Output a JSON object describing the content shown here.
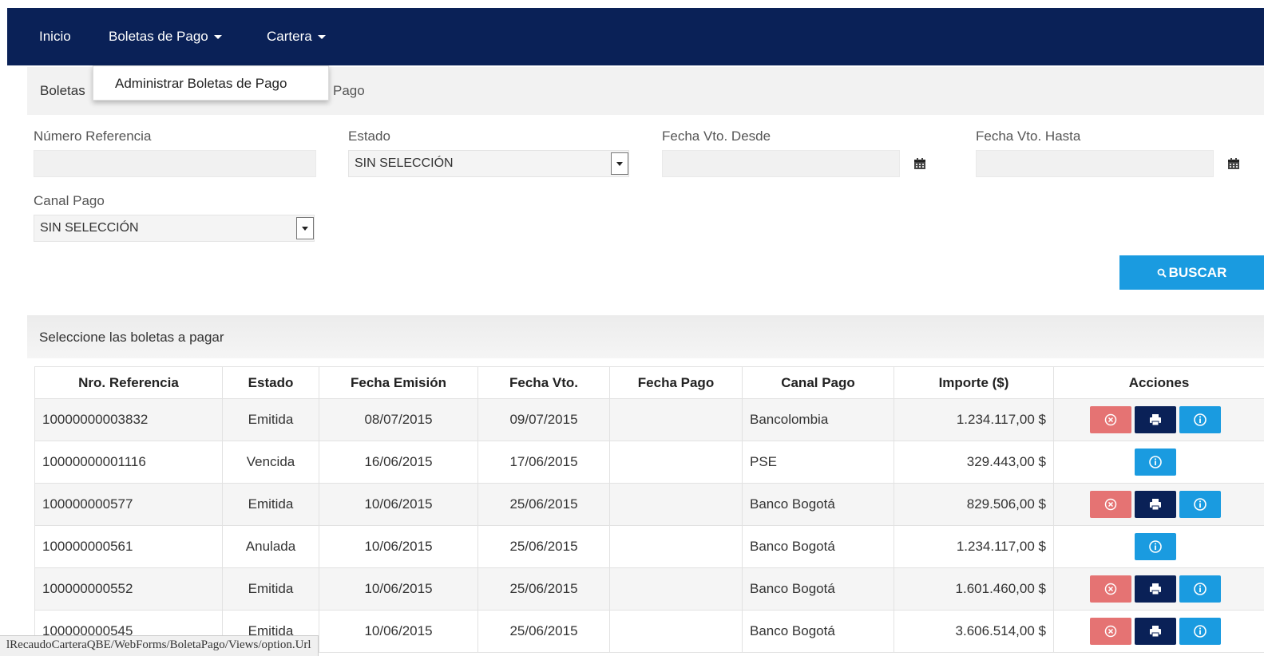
{
  "nav": {
    "items": [
      {
        "label": "Inicio"
      },
      {
        "label": "Boletas de Pago"
      },
      {
        "label": "Cartera"
      }
    ],
    "dropdown_item": "Administrar Boletas de Pago"
  },
  "breadcrumb": {
    "left": "Boletas",
    "right": "Pago"
  },
  "filters": {
    "numero_referencia": {
      "label": "Número Referencia",
      "value": ""
    },
    "estado": {
      "label": "Estado",
      "value": "SIN SELECCIÓN"
    },
    "fecha_desde": {
      "label": "Fecha Vto. Desde",
      "value": ""
    },
    "fecha_hasta": {
      "label": "Fecha Vto. Hasta",
      "value": ""
    },
    "canal_pago": {
      "label": "Canal Pago",
      "value": "SIN SELECCIÓN"
    },
    "search_button": "BUSCAR"
  },
  "section_title": "Seleccione las boletas a pagar",
  "table": {
    "headers": [
      "Nro. Referencia",
      "Estado",
      "Fecha Emisión",
      "Fecha Vto.",
      "Fecha Pago",
      "Canal Pago",
      "Importe ($)",
      "Acciones"
    ],
    "rows": [
      {
        "ref": "10000000003832",
        "estado": "Emitida",
        "emision": "08/07/2015",
        "vto": "09/07/2015",
        "pago": "",
        "canal": "Bancolombia",
        "importe": "1.234.117,00 $",
        "actions": [
          "cancel",
          "print",
          "info"
        ]
      },
      {
        "ref": "10000000001116",
        "estado": "Vencida",
        "emision": "16/06/2015",
        "vto": "17/06/2015",
        "pago": "",
        "canal": "PSE",
        "importe": "329.443,00 $",
        "actions": [
          "info"
        ]
      },
      {
        "ref": "100000000577",
        "estado": "Emitida",
        "emision": "10/06/2015",
        "vto": "25/06/2015",
        "pago": "",
        "canal": "Banco Bogotá",
        "importe": "829.506,00 $",
        "actions": [
          "cancel",
          "print",
          "info"
        ]
      },
      {
        "ref": "100000000561",
        "estado": "Anulada",
        "emision": "10/06/2015",
        "vto": "25/06/2015",
        "pago": "",
        "canal": "Banco Bogotá",
        "importe": "1.234.117,00 $",
        "actions": [
          "info"
        ]
      },
      {
        "ref": "100000000552",
        "estado": "Emitida",
        "emision": "10/06/2015",
        "vto": "25/06/2015",
        "pago": "",
        "canal": "Banco Bogotá",
        "importe": "1.601.460,00 $",
        "actions": [
          "cancel",
          "print",
          "info"
        ]
      },
      {
        "ref": "100000000545",
        "estado": "Emitida",
        "emision": "10/06/2015",
        "vto": "25/06/2015",
        "pago": "",
        "canal": "Banco Bogotá",
        "importe": "3.606.514,00 $",
        "actions": [
          "cancel",
          "print",
          "info"
        ]
      }
    ]
  },
  "status_url": "lRecaudoCarteraQBE/WebForms/BoletaPago/Views/option.Url",
  "colors": {
    "navbar": "#0a2157",
    "primary": "#1a9be0",
    "danger": "#e57373"
  }
}
